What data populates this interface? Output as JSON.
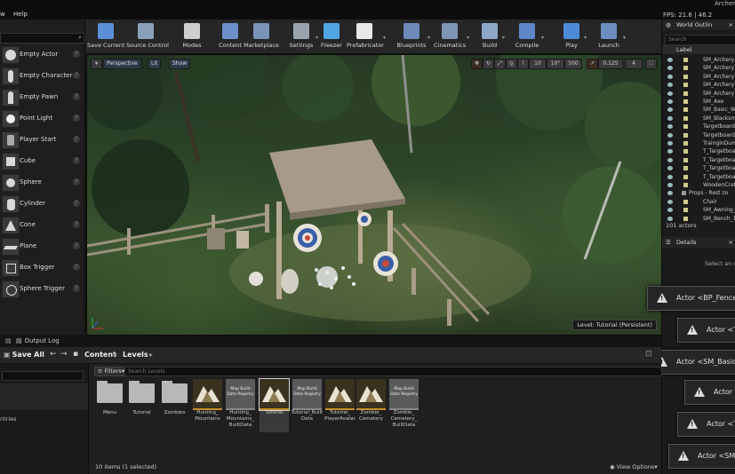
{
  "window": {
    "title": "Archer",
    "menu": [
      "w",
      "Help"
    ],
    "fps": "FPS: 21.6 | 46.2"
  },
  "toolbar": [
    {
      "label": "Save Current",
      "icon": "save-icon",
      "color": "#5b8fd6"
    },
    {
      "label": "Source Control",
      "icon": "source-control-icon",
      "color": "#8aa0b8"
    },
    {
      "label": "Modes",
      "icon": "modes-icon",
      "color": "#cfcfcf"
    },
    {
      "label": "Content",
      "icon": "content-icon",
      "color": "#6b8fc8"
    },
    {
      "label": "Marketplace",
      "icon": "marketplace-icon",
      "color": "#7a93b8"
    },
    {
      "label": "Settings",
      "icon": "settings-icon",
      "color": "#9aa3ad"
    },
    {
      "label": "Freezer",
      "icon": "freezer-icon",
      "color": "#4fa6e0"
    },
    {
      "label": "Prefabricator",
      "icon": "prefabricator-icon",
      "color": "#e8e8e8"
    },
    {
      "label": "Blueprints",
      "icon": "blueprints-icon",
      "color": "#6c89b8"
    },
    {
      "label": "Cinematics",
      "icon": "cinematics-icon",
      "color": "#7e95b5"
    },
    {
      "label": "Build",
      "icon": "build-icon",
      "color": "#8ea7c8"
    },
    {
      "label": "Compile",
      "icon": "compile-icon",
      "color": "#5f86c6"
    },
    {
      "label": "Play",
      "icon": "play-icon",
      "color": "#4c8ad8"
    },
    {
      "label": "Launch",
      "icon": "launch-icon",
      "color": "#6c8dc0"
    }
  ],
  "modes_panel": {
    "items": [
      "Empty Actor",
      "Empty Character",
      "Empty Pawn",
      "Point Light",
      "Player Start",
      "Cube",
      "Sphere",
      "Cylinder",
      "Cone",
      "Plane",
      "Box Trigger",
      "Sphere Trigger"
    ]
  },
  "viewport": {
    "buttons": [
      "Perspective",
      "Lit",
      "Show"
    ],
    "snap_values": [
      "10",
      "10°",
      "500",
      "0.125",
      "4"
    ],
    "level": "Level:  Tutorial (Persistent)"
  },
  "outliner": {
    "tab": "World Outlin",
    "search_placeholder": "Search",
    "label_col": "Label",
    "rows": [
      "SM_Archery1",
      "SM_ArcheryT",
      "SM_ArcheryT",
      "SM_ArcheryT",
      "SM_ArcheryT",
      "SM_Axe",
      "SM_Basic_Wo",
      "SM_Blacksmi",
      "Targetboard",
      "Targetboard2",
      "TrainginDum",
      "T_Targetboar",
      "T_Targetboar",
      "T_Targetboar",
      "T_Targetboar",
      "WoodenCrate",
      "Props - Rest zo",
      "Chair",
      "SM_Awning_",
      "SM_Bench_1"
    ],
    "count": "101 actors"
  },
  "details": {
    "tab": "Details",
    "hint": "Select an obj"
  },
  "notifications": [
    "Actor <BP_FenceS",
    "Actor <T_T",
    "Actor <SM_Basic_",
    "Actor",
    "Actor <T_Ta",
    "Actor <SM_A"
  ],
  "output_log": {
    "tab": "Output Log"
  },
  "content_browser": {
    "save_all": "Save All",
    "path": [
      "Content",
      "Levels"
    ],
    "filters": "Filters",
    "search_placeholder": "Search Levels",
    "left_partial": "ntries",
    "assets": [
      {
        "label": "Menu",
        "kind": "folder"
      },
      {
        "label": "Tutorial",
        "kind": "folder"
      },
      {
        "label": "Zombies",
        "kind": "folder"
      },
      {
        "label": "Hunting_ Mountains",
        "kind": "map"
      },
      {
        "label": "Hunting_ Mountains_ BuiltData",
        "kind": "builddata"
      },
      {
        "label": "Tutorial",
        "kind": "map",
        "selected": true
      },
      {
        "label": "Tutorial_Built Data",
        "kind": "builddata"
      },
      {
        "label": "Tutorial_ PlayerAvatar",
        "kind": "map"
      },
      {
        "label": "Zombie_ Cemetery",
        "kind": "map"
      },
      {
        "label": "Zombie_ Cemetery_ BuiltData",
        "kind": "builddata"
      }
    ],
    "builddata_caption": "Map Build Data Registry",
    "item_count": "10 items (1 selected)",
    "view_options": "View Options"
  }
}
